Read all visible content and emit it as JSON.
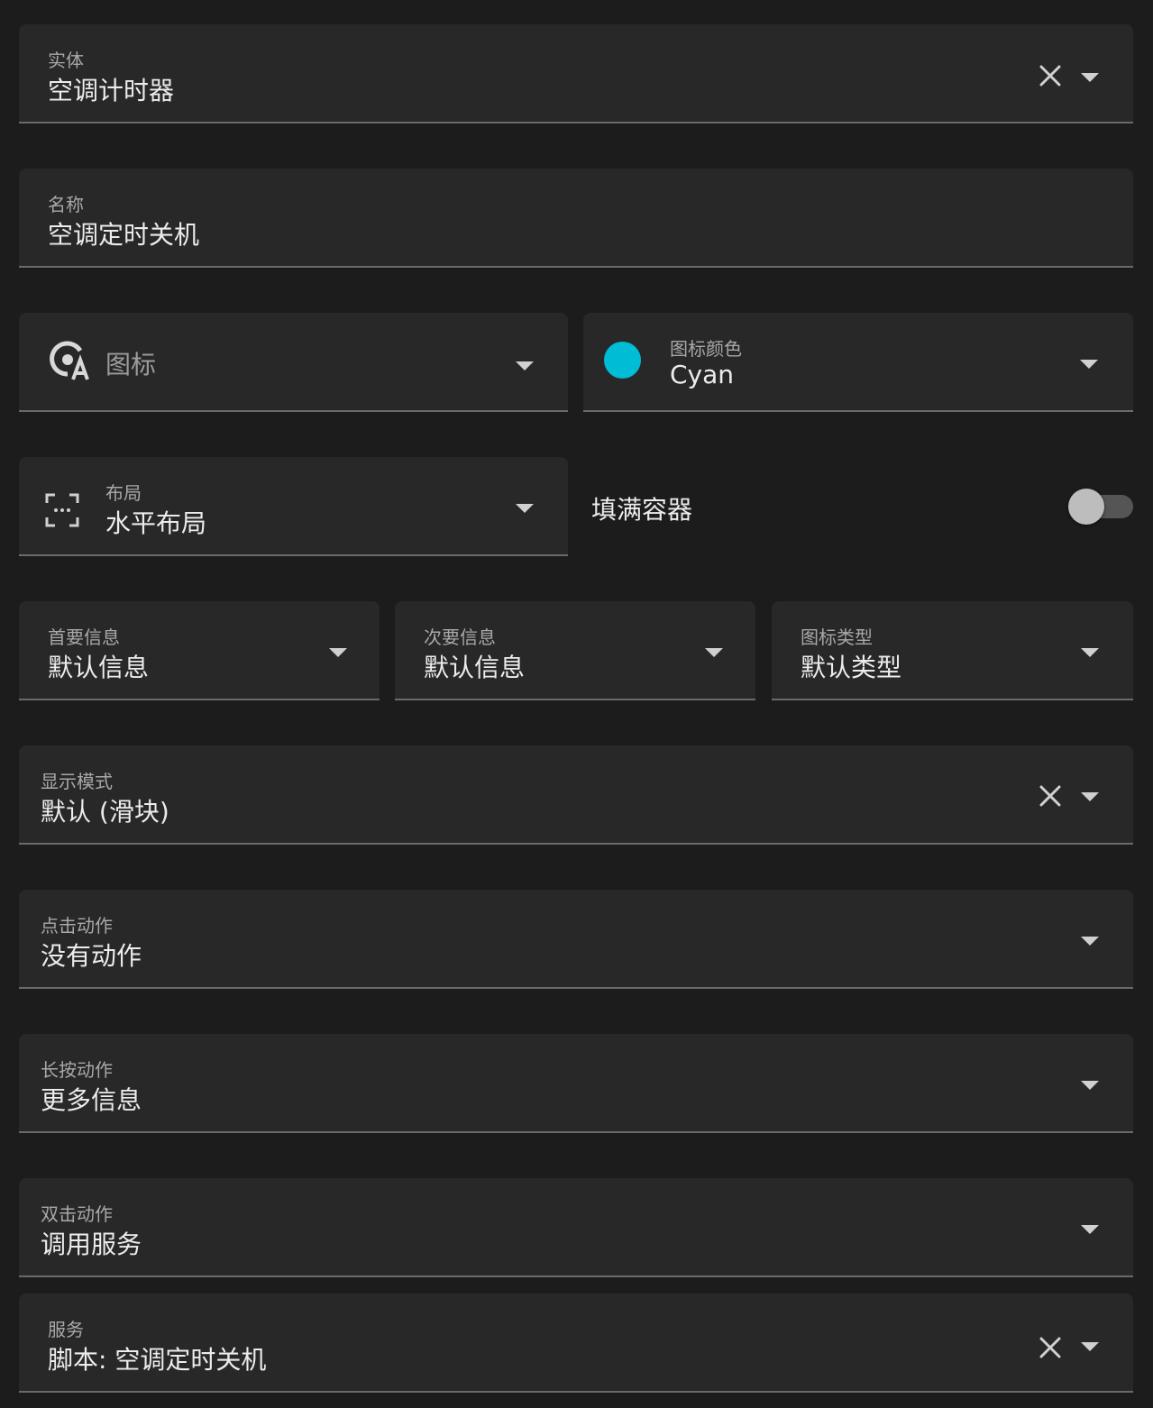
{
  "entity": {
    "label": "实体",
    "value": "空调计时器"
  },
  "name": {
    "label": "名称",
    "value": "空调定时关机"
  },
  "icon": {
    "placeholder": "图标"
  },
  "icon_color": {
    "label": "图标颜色",
    "value": "Cyan",
    "swatch": "#00bcd4"
  },
  "layout": {
    "label": "布局",
    "value": "水平布局"
  },
  "fill_container": {
    "label": "填满容器",
    "enabled": false
  },
  "primary_info": {
    "label": "首要信息",
    "value": "默认信息"
  },
  "secondary_info": {
    "label": "次要信息",
    "value": "默认信息"
  },
  "icon_type": {
    "label": "图标类型",
    "value": "默认类型"
  },
  "display_mode": {
    "label": "显示模式",
    "value": "默认 (滑块)"
  },
  "tap_action": {
    "label": "点击动作",
    "value": "没有动作"
  },
  "hold_action": {
    "label": "长按动作",
    "value": "更多信息"
  },
  "double_tap_action": {
    "label": "双击动作",
    "value": "调用服务"
  },
  "service": {
    "label": "服务",
    "value": "脚本: 空调定时关机"
  },
  "colors": {
    "background": "#1c1c1c",
    "field": "#282828",
    "underline": "#6a6a6a",
    "accent_cyan": "#00bcd4"
  }
}
